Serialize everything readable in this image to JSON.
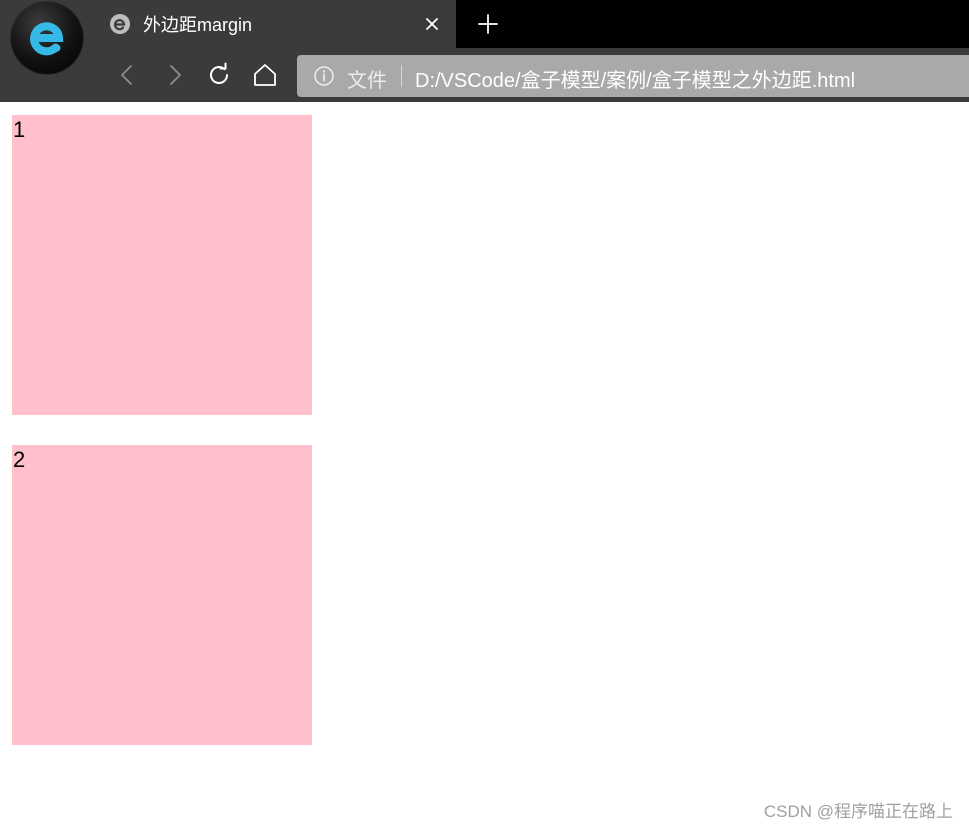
{
  "browser": {
    "tab": {
      "title": "外边距margin",
      "close_icon": "close-icon"
    },
    "new_tab_icon": "plus-icon",
    "toolbar": {
      "back_icon": "chevron-left-icon",
      "forward_icon": "chevron-right-icon",
      "reload_icon": "reload-icon",
      "home_icon": "home-icon"
    },
    "address_bar": {
      "scheme_label": "文件",
      "url": "D:/VSCode/盒子模型/案例/盒子模型之外边距.html"
    }
  },
  "page": {
    "boxes": [
      {
        "label": "1"
      },
      {
        "label": "2"
      }
    ]
  },
  "watermark": "CSDN @程序喵正在路上",
  "colors": {
    "chrome": "#3b3b3b",
    "tabstrip": "#000000",
    "address_bg": "#a9a9a9",
    "box": "#ffc0cb"
  }
}
